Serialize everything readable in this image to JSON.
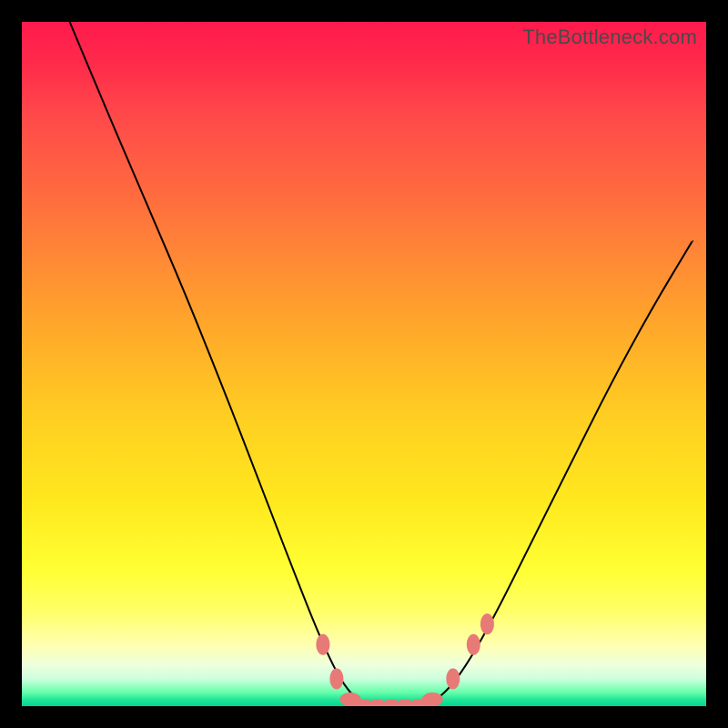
{
  "watermark": "TheBottleneck.com",
  "colors": {
    "background": "#000000",
    "curve": "#000000",
    "marker": "#e77a77"
  },
  "chart_data": {
    "type": "line",
    "title": "",
    "xlabel": "",
    "ylabel": "",
    "xlim": [
      0,
      100
    ],
    "ylim": [
      0,
      100
    ],
    "grid": false,
    "legend": false,
    "note": "V-shaped bottleneck curve. y represents bottleneck percentage (100 at top, 0 at bottom). Values estimated from pixel positions.",
    "series": [
      {
        "name": "bottleneck-curve",
        "x": [
          7,
          12,
          18,
          24,
          30,
          35,
          40,
          44,
          47,
          50,
          53,
          56,
          59,
          62,
          65,
          69,
          74,
          80,
          86,
          92,
          98
        ],
        "y": [
          100,
          88,
          74,
          60,
          45,
          32,
          19,
          9,
          3,
          0,
          0,
          0,
          0,
          2,
          6,
          13,
          23,
          35,
          47,
          58,
          68
        ]
      }
    ],
    "markers": {
      "name": "highlight-dots",
      "note": "Salmon markers near the trough of the curve.",
      "points": [
        {
          "x": 44,
          "y": 9
        },
        {
          "x": 46,
          "y": 4
        },
        {
          "x": 48,
          "y": 1
        },
        {
          "x": 50,
          "y": 0
        },
        {
          "x": 52,
          "y": 0
        },
        {
          "x": 54,
          "y": 0
        },
        {
          "x": 56,
          "y": 0
        },
        {
          "x": 58,
          "y": 0
        },
        {
          "x": 60,
          "y": 1
        },
        {
          "x": 63,
          "y": 4
        },
        {
          "x": 66,
          "y": 9
        },
        {
          "x": 68,
          "y": 12
        }
      ]
    }
  }
}
